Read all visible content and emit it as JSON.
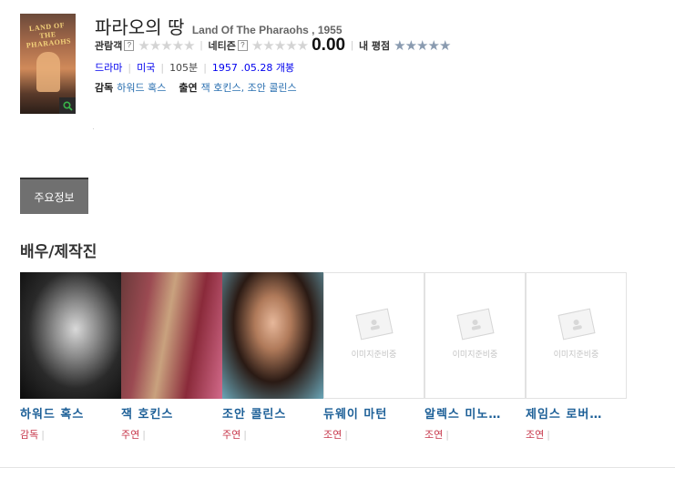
{
  "movie": {
    "title_ko": "파라오의 땅",
    "title_en": "Land Of The Pharaohs , 1955",
    "poster_title": "LAND OF THE PHARAOHS"
  },
  "ratings": {
    "audience_label": "관람객",
    "netizen_label": "네티즌",
    "netizen_score": "0.00",
    "my_label": "내 평점",
    "help_mark": "?",
    "empty_stars": "★★★★★"
  },
  "meta": {
    "genre": "드라마",
    "country": "미국",
    "runtime": "105분",
    "release": "1957 .05.28 개봉"
  },
  "credits": {
    "director_label": "감독",
    "director": "하워드 혹스",
    "cast_label": "출연",
    "actors": "잭 호킨스, 조안 콜린스"
  },
  "tab": {
    "label": "주요정보"
  },
  "section": {
    "title": "배우/제작진"
  },
  "cast": [
    {
      "name": "하워드 혹스",
      "role": "감독"
    },
    {
      "name": "잭 호킨스",
      "role": "주연"
    },
    {
      "name": "조안 콜린스",
      "role": "주연"
    },
    {
      "name": "듀웨이 마턴",
      "role": "조연",
      "placeholder": "이미지준비중"
    },
    {
      "name": "알렉스 미노…",
      "role": "조연",
      "placeholder": "이미지준비중"
    },
    {
      "name": "제임스 로버…",
      "role": "조연",
      "placeholder": "이미지준비중"
    }
  ]
}
